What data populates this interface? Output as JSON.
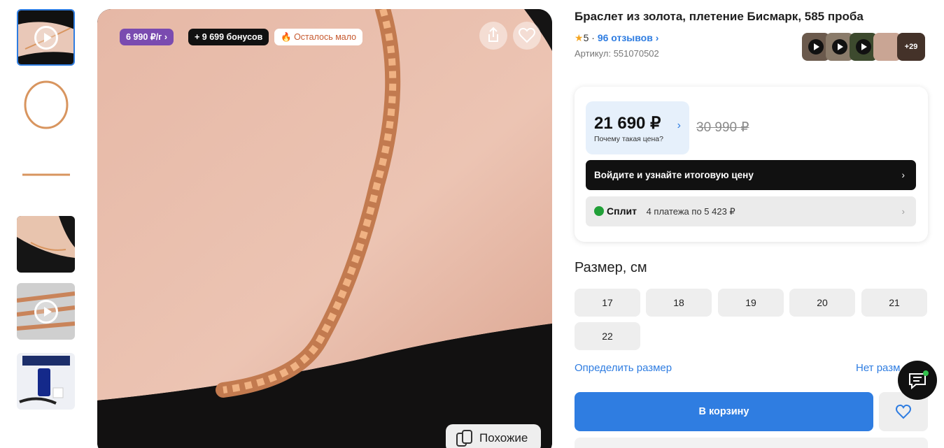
{
  "thumbnails": [
    {
      "kind": "video",
      "subject": "bracelet-on-wrist",
      "active": true
    },
    {
      "kind": "image",
      "subject": "bracelet-loop"
    },
    {
      "kind": "image",
      "subject": "bracelet-flat"
    },
    {
      "kind": "image",
      "subject": "bracelet-on-wrist-dark"
    },
    {
      "kind": "video",
      "subject": "bracelet-closeup"
    },
    {
      "kind": "image",
      "subject": "cleaning-kit"
    }
  ],
  "badges": {
    "price_per_gram": "6 990 ₽/г",
    "bonus": "+ 9 699 бонусов",
    "stock": "Осталось мало"
  },
  "similar_label": "Похожие",
  "product": {
    "title": "Браслет из золота, плетение Бисмарк, 585 проба",
    "rating": "5",
    "reviews_label": "96 отзывов",
    "sku": "Артикул: 551070502",
    "review_more": "+29"
  },
  "price": {
    "current": "21 690 ₽",
    "why_label": "Почему такая цена?",
    "old": "30 990 ₽",
    "login_label": "Войдите и узнайте итоговую цену",
    "split_name": "Сплит",
    "split_text": "4 платежа по 5 423 ₽"
  },
  "sizes": {
    "title": "Размер, см",
    "options": [
      "17",
      "18",
      "19",
      "20",
      "21",
      "22"
    ],
    "determine_label": "Определить размер",
    "missing_label": "Нет разм"
  },
  "actions": {
    "cart_label": "В корзину"
  },
  "colors": {
    "accent": "#2f7de1",
    "badge_purple": "#7a4bb0",
    "gold": "#d8955f"
  }
}
